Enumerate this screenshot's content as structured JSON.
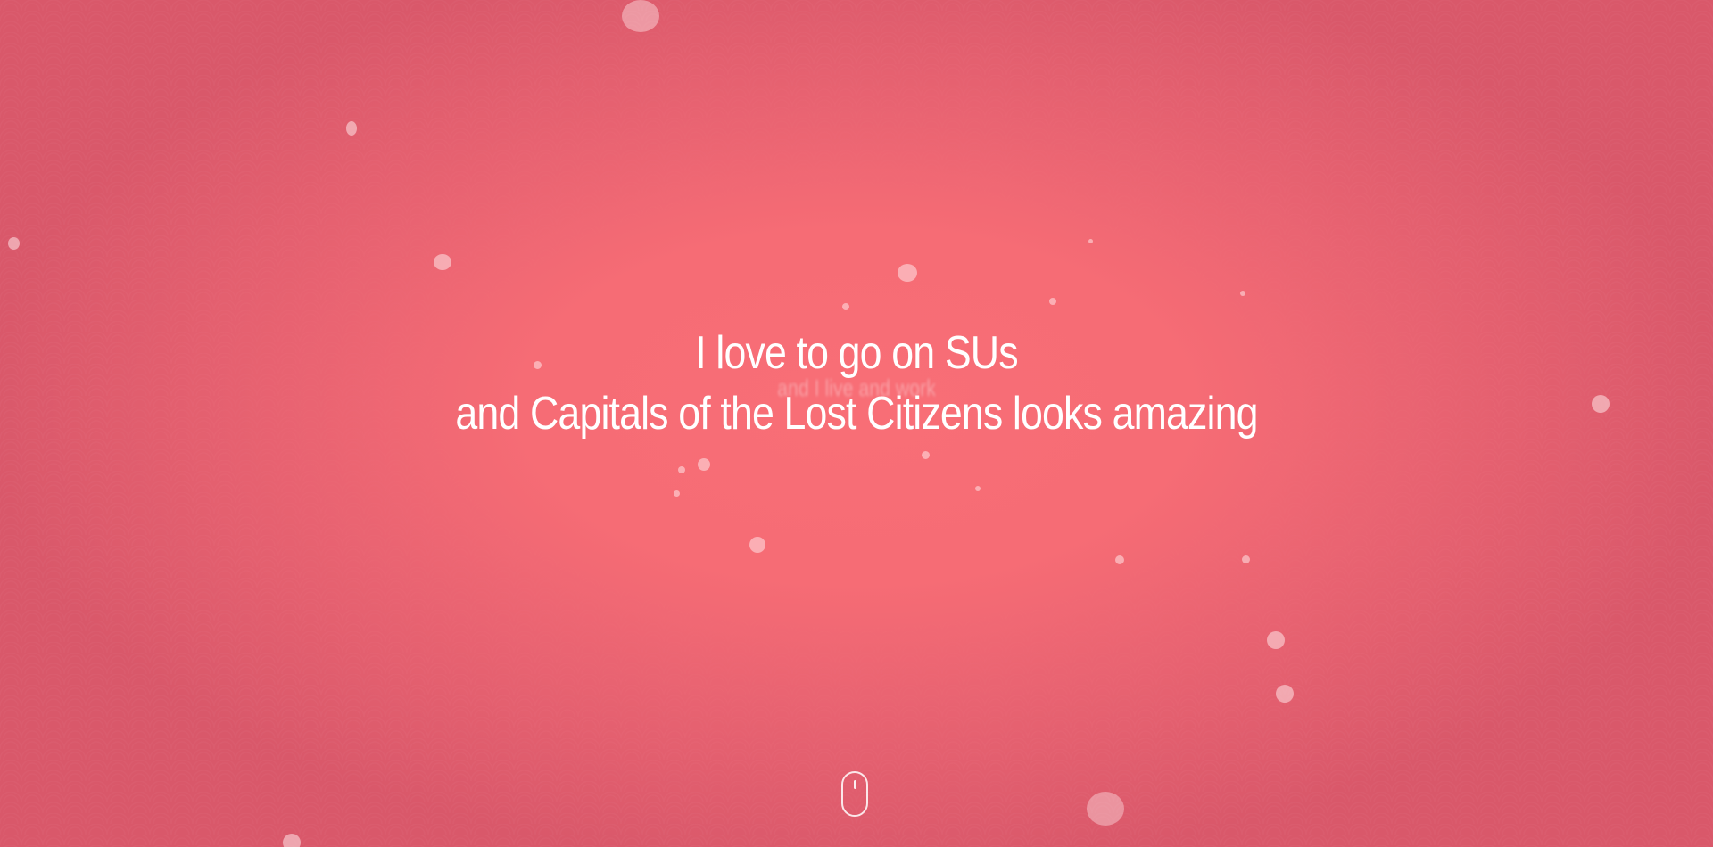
{
  "hero": {
    "line1": "I love to go on SUs",
    "line2": "and Capitals of the Lost Citizens looks amazing"
  },
  "ghost_text": {
    "line1": "and I live and work"
  },
  "scroll_indicator": {
    "icon": "mouse-scroll-icon"
  },
  "colors": {
    "background_center": "#f86e76",
    "background_edge": "#d9586a",
    "text": "#ffffff"
  }
}
